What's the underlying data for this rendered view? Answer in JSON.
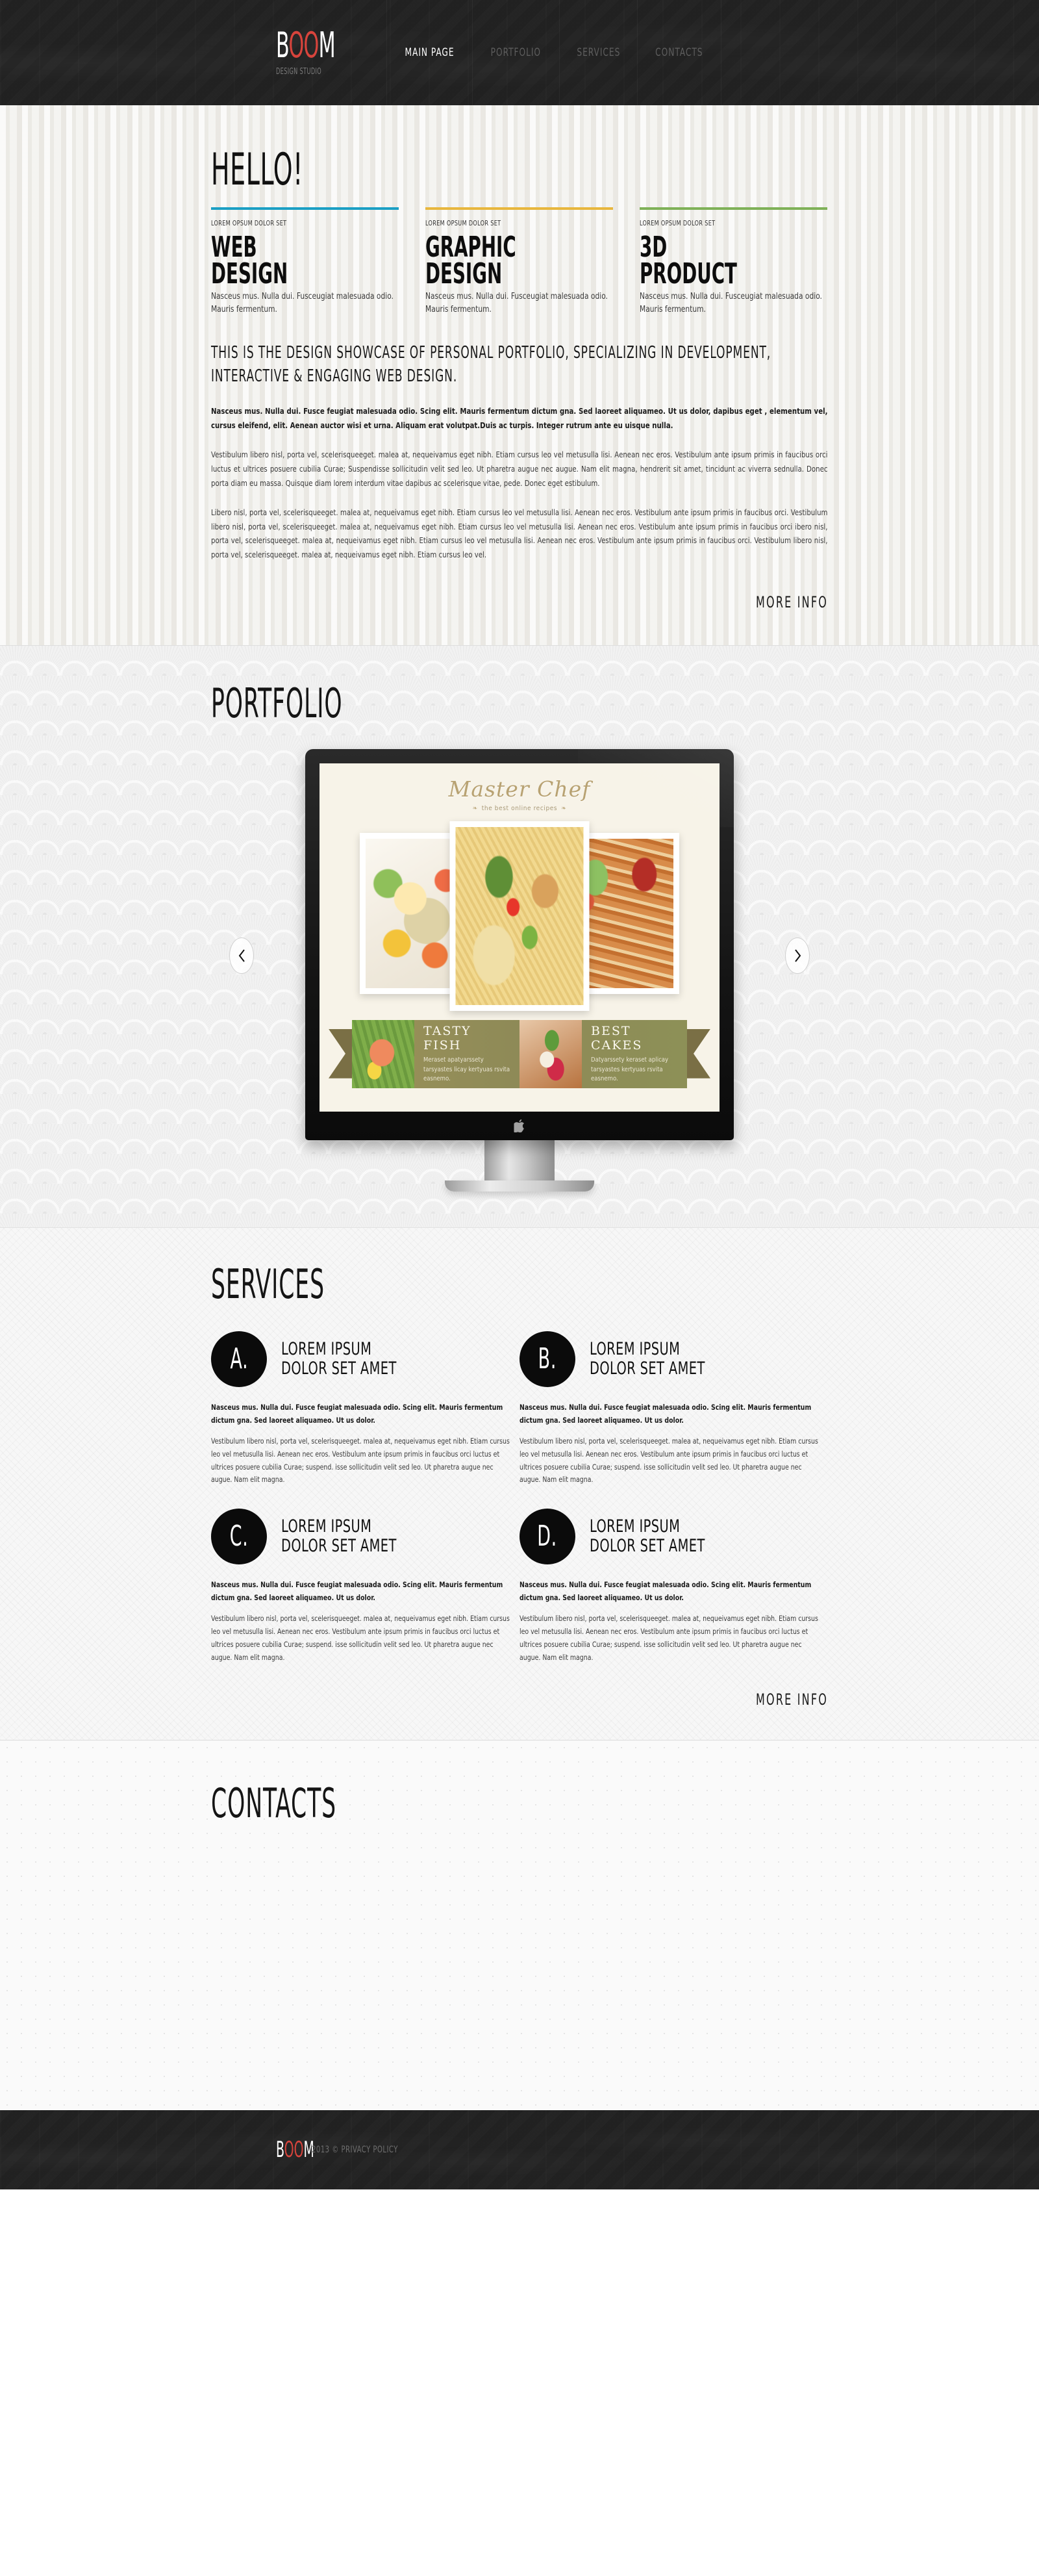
{
  "header": {
    "logo": {
      "pre": "B",
      "mid": "OO",
      "post": "M",
      "tagline": "DESIGN STUDIO"
    },
    "nav": [
      {
        "label": "MAIN PAGE",
        "active": true
      },
      {
        "label": "PORTFOLIO",
        "active": false
      },
      {
        "label": "SERVICES",
        "active": false
      },
      {
        "label": "CONTACTS",
        "active": false
      }
    ]
  },
  "hero": {
    "greeting": "HELLO!",
    "columns": [
      {
        "rule_color": "#1b9fc4",
        "kicker": "LOREM OPSUM DOLOR SET",
        "title": "WEB\nDESIGN",
        "desc": "Nasceus mus. Nulla dui.  Fusceugiat malesuada odio. Mauris fermentum."
      },
      {
        "rule_color": "#e8b73e",
        "kicker": "LOREM OPSUM DOLOR SET",
        "title": "GRAPHIC\nDESIGN",
        "desc": "Nasceus mus. Nulla dui.  Fusceugiat malesuada odio. Mauris fermentum."
      },
      {
        "rule_color": "#7fb158",
        "kicker": "LOREM OPSUM DOLOR SET",
        "title": "3D\nPRODUCT",
        "desc": "Nasceus mus. Nulla dui.  Fusceugiat malesuada odio. Mauris fermentum."
      }
    ],
    "lead": "THIS IS THE DESIGN SHOWCASE OF PERSONAL PORTFOLIO, SPECIALIZING IN DEVELOPMENT, INTERACTIVE & ENGAGING WEB DESIGN.",
    "paragraph_bold": "Nasceus mus. Nulla dui.  Fusce feugiat malesuada odio.  Scing elit. Mauris fermentum dictum gna. Sed laoreet aliquameo.  Ut us dolor, dapibus eget , elementum vel, cursus eleifend, elit. Aenean auctor wisi et urna. Aliquam erat volutpat.Duis ac turpis. Integer rutrum ante eu uisque nulla.",
    "paragraph_one": "Vestibulum libero nisl, porta vel, scelerisqueeget. malea at, nequeivamus eget nibh. Etiam cursus leo vel metusulla lisi.  Aenean nec eros. Vestibulum ante ipsum primis in faucibus orci luctus et ultrices posuere cubilia Curae; Suspendisse sollicitudin velit sed leo. Ut pharetra augue nec augue. Nam elit magna, hendrerit sit amet, tincidunt ac viverra sednulla. Donec porta diam eu massa.  Quisque diam lorem interdum vitae dapibus ac  scelerisque vitae, pede. Donec eget estibulum.",
    "paragraph_two": "Libero nisl, porta vel, scelerisqueeget. malea at, nequeivamus eget nibh. Etiam cursus leo vel metusulla lisi.  Aenean nec eros. Vestibulum ante ipsum primis in faucibus orci. Vestibulum libero nisl, porta vel, scelerisqueeget. malea at, nequeivamus eget nibh. Etiam cursus leo vel metusulla lisi.  Aenean nec eros.  Vestibulum ante ipsum primis in faucibus orci ibero nisl, porta vel, scelerisqueeget. malea at, nequeivamus eget nibh. Etiam cursus leo vel metusulla lisi.  Aenean nec eros. Vestibulum ante ipsum primis in faucibus orci. Vestibulum libero nisl, porta vel, scelerisqueeget. malea at, nequeivamus eget nibh. Etiam cursus leo vel.",
    "more_info": "MORE INFO"
  },
  "portfolio": {
    "title": "PORTFOLIO",
    "prev_arrow": "‹",
    "next_arrow": "›",
    "screenshot": {
      "brand_title": "Master Chef",
      "brand_sub": "the best online recipes",
      "leaf_glyph": "❧",
      "ribbon": [
        {
          "title": "TASTY FISH",
          "desc": "Meraset apatyarssety tarsyastes licay kertyuas rsvita easnemo."
        },
        {
          "title": "BEST CAKES",
          "desc": "Datyarssety keraset aplicay tarsyastes kertyuas rsvita easnemo."
        }
      ]
    }
  },
  "services": {
    "title": "SERVICES",
    "items": [
      {
        "letter": "A.",
        "title": "LOREM IPSUM\nDOLOR SET AMET",
        "lead": "Nasceus mus. Nulla dui.  Fusce feugiat malesuada odio.  Scing elit. Mauris fermentum dictum gna. Sed laoreet aliquameo.  Ut us dolor.",
        "body": "Vestibulum libero nisl, porta vel, scelerisqueeget. malea at, nequeivamus eget nibh. Etiam cursus leo vel metusulla lisi.  Aenean nec eros. Vestibulum ante ipsum primis in faucibus orci luctus et ultrices posuere cubilia Curae; suspend. isse sollicitudin velit sed leo. Ut pharetra augue nec augue. Nam elit magna."
      },
      {
        "letter": "B.",
        "title": "LOREM IPSUM\nDOLOR SET AMET",
        "lead": "Nasceus mus. Nulla dui.  Fusce feugiat malesuada odio.  Scing elit. Mauris fermentum dictum gna. Sed laoreet aliquameo.  Ut us dolor.",
        "body": "Vestibulum libero nisl, porta vel, scelerisqueeget. malea at, nequeivamus eget nibh. Etiam cursus leo vel metusulla lisi.  Aenean nec eros. Vestibulum ante ipsum primis in faucibus orci luctus et ultrices posuere cubilia Curae; suspend. isse sollicitudin velit sed leo. Ut pharetra augue nec augue. Nam elit magna."
      },
      {
        "letter": "C.",
        "title": "LOREM IPSUM\nDOLOR SET AMET",
        "lead": "Nasceus mus. Nulla dui.  Fusce feugiat malesuada odio.  Scing elit. Mauris fermentum dictum gna. Sed laoreet aliquameo.  Ut us dolor.",
        "body": "Vestibulum libero nisl, porta vel, scelerisqueeget. malea at, nequeivamus eget nibh. Etiam cursus leo vel metusulla lisi.  Aenean nec eros. Vestibulum ante ipsum primis in faucibus orci luctus et ultrices posuere cubilia Curae; suspend. isse sollicitudin velit sed leo. Ut pharetra augue nec augue. Nam elit magna."
      },
      {
        "letter": "D.",
        "title": "LOREM IPSUM\nDOLOR SET AMET",
        "lead": "Nasceus mus. Nulla dui.  Fusce feugiat malesuada odio.  Scing elit. Mauris fermentum dictum gna. Sed laoreet aliquameo.  Ut us dolor.",
        "body": "Vestibulum libero nisl, porta vel, scelerisqueeget. malea at, nequeivamus eget nibh. Etiam cursus leo vel metusulla lisi.  Aenean nec eros. Vestibulum ante ipsum primis in faucibus orci luctus et ultrices posuere cubilia Curae; suspend. isse sollicitudin velit sed leo. Ut pharetra augue nec augue. Nam elit magna."
      }
    ],
    "more_info": "MORE INFO"
  },
  "contacts": {
    "title": "CONTACTS"
  },
  "footer": {
    "logo": {
      "pre": "B",
      "mid": "OO",
      "post": "M"
    },
    "copyright": "2013 © PRIVACY POLICY"
  },
  "colors": {
    "dark_bar": "#222222",
    "accent_red": "#d8443c",
    "rule_blue": "#1b9fc4",
    "rule_yellow": "#e8b73e",
    "rule_green": "#7fb158"
  }
}
